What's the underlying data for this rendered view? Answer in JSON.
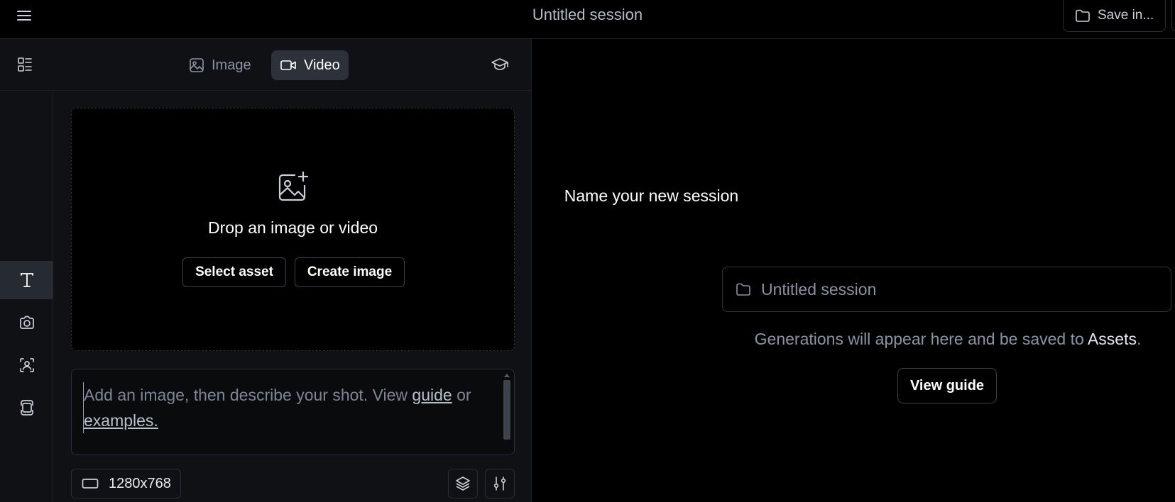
{
  "topbar": {
    "menu_icon": "hamburger-menu-icon",
    "title": "Untitled session",
    "save_label": "Save in...",
    "save_icon": "folder-icon"
  },
  "left_panel": {
    "layout_icon": "layout-list-icon",
    "tabs": [
      {
        "label": "Image",
        "icon": "image-icon",
        "active": false
      },
      {
        "label": "Video",
        "icon": "video-camera-icon",
        "active": true
      }
    ],
    "learn_icon": "graduation-cap-icon",
    "tools": [
      {
        "icon": "text-icon",
        "active": true
      },
      {
        "icon": "camera-icon",
        "active": false
      },
      {
        "icon": "character-icon",
        "active": false
      },
      {
        "icon": "frames-icon",
        "active": false
      }
    ],
    "dropzone": {
      "icon": "image-plus-icon",
      "title": "Drop an image or video",
      "select_asset": "Select asset",
      "create_image": "Create image"
    },
    "prompt": {
      "text_before": "Add an image, then describe your shot. View ",
      "guide_link": "guide",
      "text_mid": " or",
      "examples_link": "examples."
    },
    "resolution": {
      "value": "1280x768",
      "icon": "aspect-ratio-icon"
    },
    "layers_icon": "layers-icon",
    "settings_icon": "sliders-icon"
  },
  "session": {
    "heading": "Name your new session",
    "input_placeholder": "Untitled session",
    "input_icon": "folder-icon",
    "note_prefix": "Generations will appear here and be saved to ",
    "note_link": "Assets",
    "note_suffix": ".",
    "guide_button": "View guide"
  },
  "colors": {
    "background": "#000000",
    "panel": "#0f1114",
    "active_tab": "#2d3139",
    "muted_text": "#8a92a3"
  }
}
